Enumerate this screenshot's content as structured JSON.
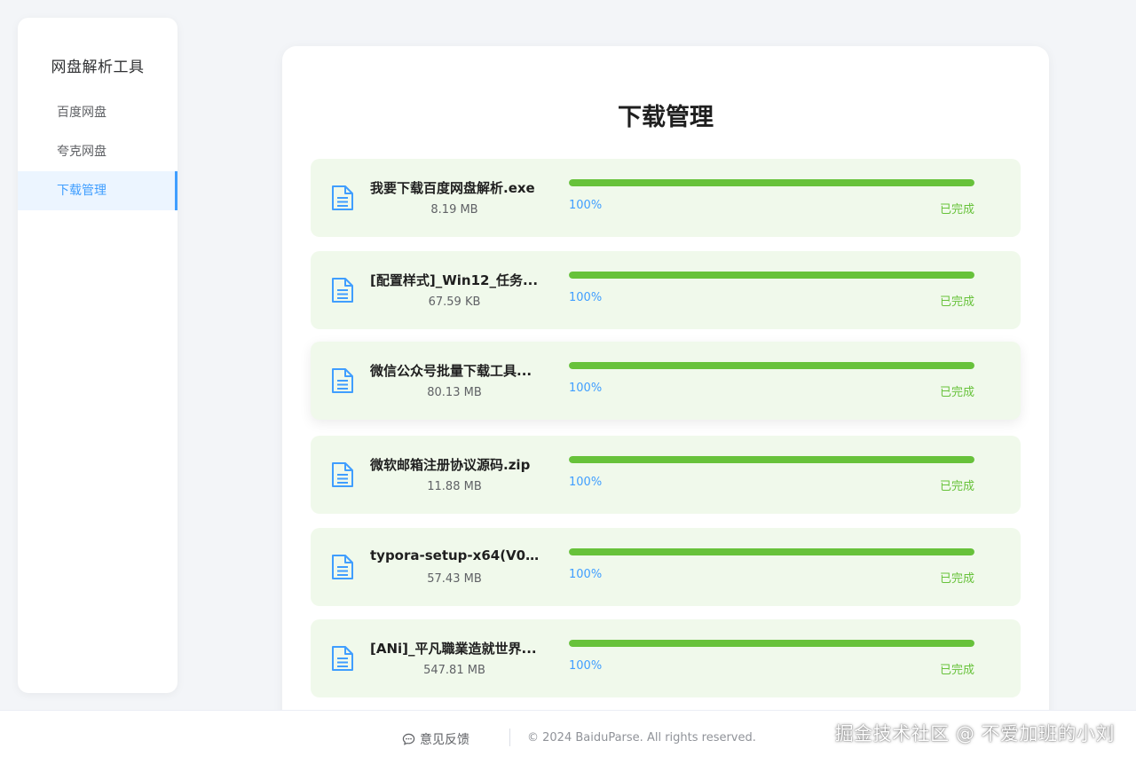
{
  "sidebar": {
    "title": "网盘解析工具",
    "items": [
      {
        "label": "百度网盘"
      },
      {
        "label": "夸克网盘"
      },
      {
        "label": "下载管理"
      }
    ]
  },
  "main": {
    "title": "下载管理",
    "downloads": [
      {
        "name": "我要下载百度网盘解析.exe",
        "size": "8.19 MB",
        "progress": "100%",
        "status": "已完成"
      },
      {
        "name": "[配置样式]_Win12_任务...",
        "size": "67.59 KB",
        "progress": "100%",
        "status": "已完成"
      },
      {
        "name": "微信公众号批量下载工具...",
        "size": "80.13 MB",
        "progress": "100%",
        "status": "已完成"
      },
      {
        "name": "微软邮箱注册协议源码.zip",
        "size": "11.88 MB",
        "progress": "100%",
        "status": "已完成"
      },
      {
        "name": "typora-setup-x64(V0.9.9...",
        "size": "57.43 MB",
        "progress": "100%",
        "status": "已完成"
      },
      {
        "name": "[ANi]_平凡職業造就世界...",
        "size": "547.81 MB",
        "progress": "100%",
        "status": "已完成"
      }
    ]
  },
  "footer": {
    "feedback": "意见反馈",
    "copyright": "© 2024 BaiduParse. All rights reserved."
  },
  "watermark": "掘金技术社区 @ 不爱加班的小刘",
  "colors": {
    "accent": "#409eff",
    "success": "#67c23a",
    "item_bg": "#f0f9eb",
    "page_bg": "#f3f5f8"
  },
  "icons": {
    "file": "document-icon",
    "feedback": "chat-bubble-icon"
  }
}
